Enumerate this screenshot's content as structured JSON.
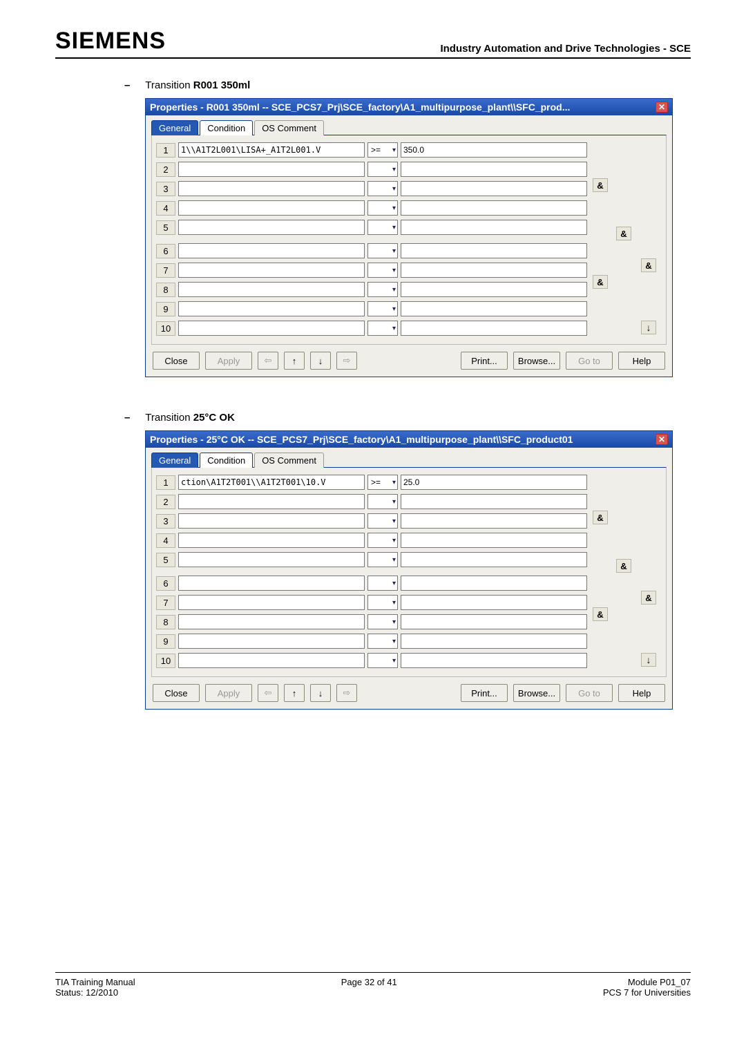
{
  "header": {
    "logo": "SIEMENS",
    "right": "Industry Automation and Drive Technologies - SCE"
  },
  "sections": [
    {
      "dash": "–",
      "prefix": "Transition ",
      "bold": "R001 350ml"
    },
    {
      "dash": "–",
      "prefix": "Transition ",
      "bold": "25°C OK"
    }
  ],
  "dialogs": [
    {
      "title": "Properties -  R001 350ml -- SCE_PCS7_Prj\\SCE_factory\\A1_multipurpose_plant\\\\SFC_prod...",
      "tabs": {
        "general": "General",
        "condition": "Condition",
        "os": "OS Comment"
      },
      "rows": [
        {
          "n": "1",
          "addr": "1\\\\A1T2L001\\LISA+_A1T2L001.V",
          "op": ">=",
          "val": "350.0"
        },
        {
          "n": "2",
          "addr": "",
          "op": "",
          "val": ""
        },
        {
          "n": "3",
          "addr": "",
          "op": "",
          "val": ""
        },
        {
          "n": "4",
          "addr": "",
          "op": "",
          "val": ""
        },
        {
          "n": "5",
          "addr": "",
          "op": "",
          "val": ""
        },
        {
          "n": "6",
          "addr": "",
          "op": "",
          "val": ""
        },
        {
          "n": "7",
          "addr": "",
          "op": "",
          "val": ""
        },
        {
          "n": "8",
          "addr": "",
          "op": "",
          "val": ""
        },
        {
          "n": "9",
          "addr": "",
          "op": "",
          "val": ""
        },
        {
          "n": "10",
          "addr": "",
          "op": "",
          "val": ""
        }
      ],
      "buttons": {
        "close": "Close",
        "apply": "Apply",
        "print": "Print...",
        "browse": "Browse...",
        "goto": "Go to",
        "help": "Help"
      }
    },
    {
      "title": "Properties -  25°C OK -- SCE_PCS7_Prj\\SCE_factory\\A1_multipurpose_plant\\\\SFC_product01",
      "tabs": {
        "general": "General",
        "condition": "Condition",
        "os": "OS Comment"
      },
      "rows": [
        {
          "n": "1",
          "addr": "ction\\A1T2T001\\\\A1T2T001\\10.V",
          "op": ">=",
          "val": "25.0"
        },
        {
          "n": "2",
          "addr": "",
          "op": "",
          "val": ""
        },
        {
          "n": "3",
          "addr": "",
          "op": "",
          "val": ""
        },
        {
          "n": "4",
          "addr": "",
          "op": "",
          "val": ""
        },
        {
          "n": "5",
          "addr": "",
          "op": "",
          "val": ""
        },
        {
          "n": "6",
          "addr": "",
          "op": "",
          "val": ""
        },
        {
          "n": "7",
          "addr": "",
          "op": "",
          "val": ""
        },
        {
          "n": "8",
          "addr": "",
          "op": "",
          "val": ""
        },
        {
          "n": "9",
          "addr": "",
          "op": "",
          "val": ""
        },
        {
          "n": "10",
          "addr": "",
          "op": "",
          "val": ""
        }
      ],
      "buttons": {
        "close": "Close",
        "apply": "Apply",
        "print": "Print...",
        "browse": "Browse...",
        "goto": "Go to",
        "help": "Help"
      }
    }
  ],
  "footer": {
    "left1": "TIA Training Manual",
    "left2": "Status: 12/2010",
    "center": "Page 32 of 41",
    "right1": "Module P01_07",
    "right2": "PCS 7 for Universities"
  },
  "glyph": {
    "and": "&",
    "down": "▾",
    "left": "⇦",
    "up": "↑",
    "dn": "↓",
    "right": "⇨",
    "more": "↓"
  }
}
